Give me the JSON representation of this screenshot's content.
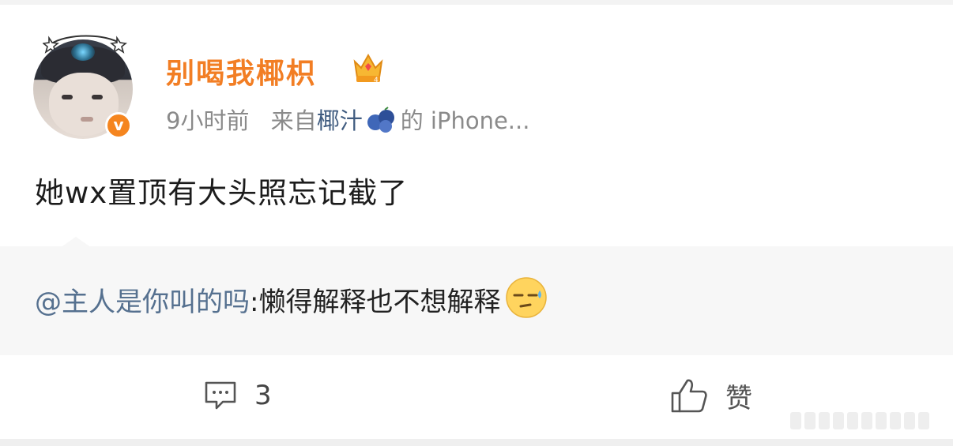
{
  "post": {
    "username": "别喝我椰枳",
    "time": "9小时前",
    "source_prefix": "来自",
    "source_app": "椰汁",
    "source_suffix": "的 iPhone...",
    "text": "她wx置顶有大头照忘记截了"
  },
  "repost": {
    "mention": "@主人是你叫的吗",
    "content": ":懒得解释也不想解释"
  },
  "actions": {
    "comment_count": "3",
    "like_label": "赞"
  },
  "icons": {
    "verified": "verified-v-badge-icon",
    "crown": "crown-icon",
    "emoji": "sweat-face-emoji-icon",
    "comment": "comment-icon",
    "like": "thumbs-up-icon"
  },
  "colors": {
    "username": "#f27e24",
    "verified_badge": "#f5851f",
    "mention": "#55708f",
    "meta": "#8a8a8a"
  }
}
